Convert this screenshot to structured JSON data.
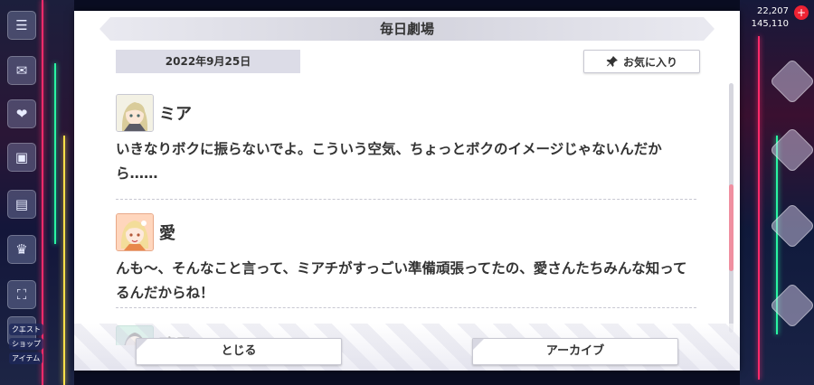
{
  "dialog": {
    "title": "毎日劇場",
    "date": "2022年9月25日",
    "favorite_label": "お気に入り",
    "entries": [
      {
        "speaker": "ミア",
        "line": "いきなりボクに振らないでよ。こういう空気、ちょっとボクのイメージじゃないんだから……"
      },
      {
        "speaker": "愛",
        "line": "んも〜、そんなこと言って、ミアチがすっごい準備頑張ってたの、愛さんたちみんな知ってるんだからね！"
      },
      {
        "speaker": "璃子"
      }
    ],
    "close_label": "とじる",
    "archive_label": "アーカイブ"
  },
  "background": {
    "currency_top": "22,207",
    "currency_bottom": "145,110",
    "side_labels": [
      "クエスト",
      "ショップ",
      "アイテム"
    ]
  }
}
